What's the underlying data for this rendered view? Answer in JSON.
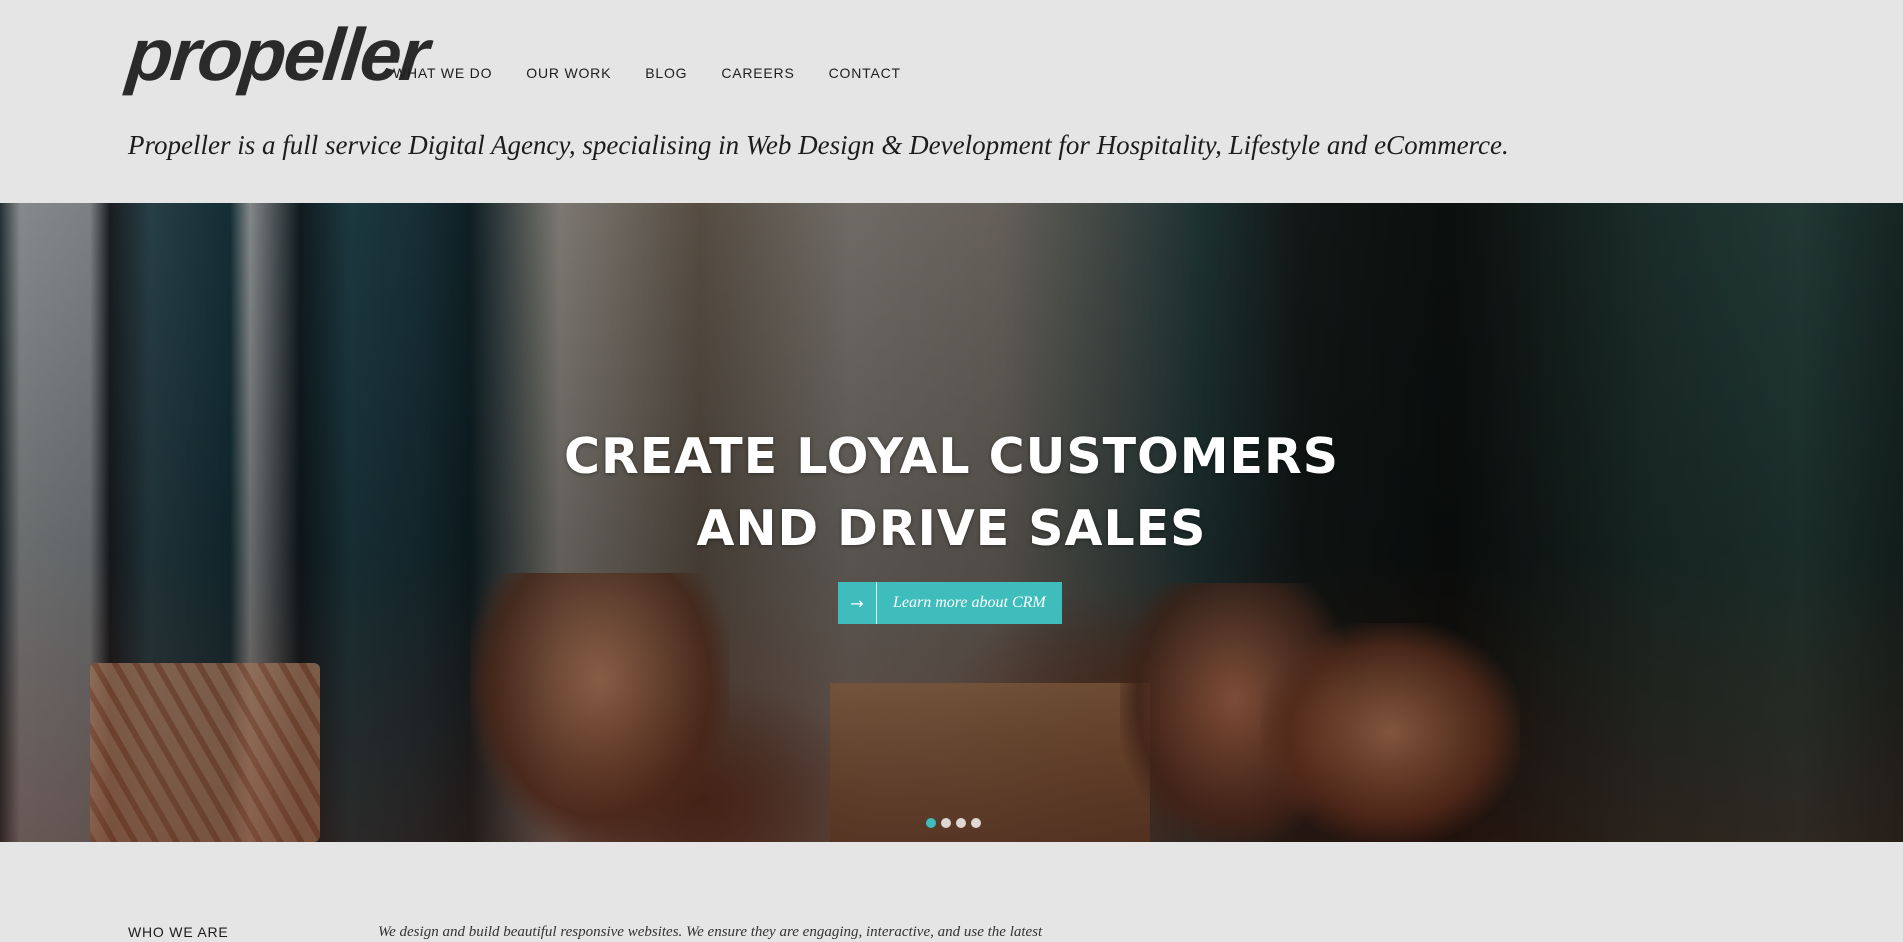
{
  "header": {
    "logo_text": "propeller",
    "nav": [
      {
        "label": "WHAT WE DO"
      },
      {
        "label": "OUR WORK"
      },
      {
        "label": "BLOG"
      },
      {
        "label": "CAREERS"
      },
      {
        "label": "CONTACT"
      }
    ],
    "tagline": "Propeller is a full service Digital Agency, specialising in Web Design & Development for  Hospitality,  Lifestyle  and  eCommerce."
  },
  "hero": {
    "title_line1": "CREATE LOYAL CUSTOMERS",
    "title_line2": "AND DRIVE SALES",
    "cta_arrow": "→",
    "cta_label": "Learn more about CRM",
    "slide_count": 4,
    "active_slide": 1,
    "accent_color": "#3fbdbd"
  },
  "about": {
    "heading": "WHO WE ARE",
    "text": "We design and build beautiful responsive websites. We ensure they are engaging, interactive, and use the latest"
  }
}
